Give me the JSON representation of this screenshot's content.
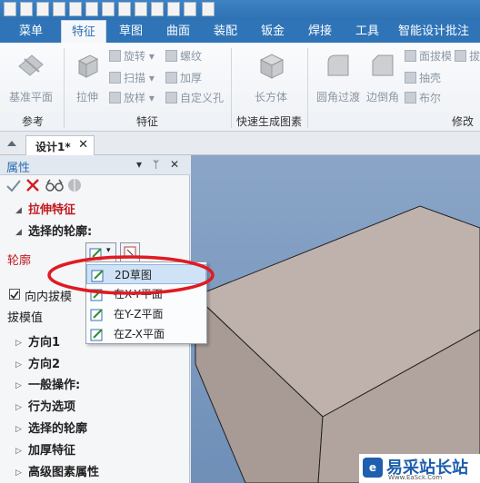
{
  "ribbon": {
    "tabs": [
      {
        "label": "菜单"
      },
      {
        "label": "特征"
      },
      {
        "label": "草图"
      },
      {
        "label": "曲面"
      },
      {
        "label": "装配"
      },
      {
        "label": "钣金"
      },
      {
        "label": "焊接"
      },
      {
        "label": "工具"
      },
      {
        "label": "智能设计批注"
      }
    ],
    "active_tab": "特征",
    "groups": {
      "reference": {
        "label": "参考",
        "base_plane": "基准平面"
      },
      "feature": {
        "label": "特征",
        "extrude": "拉伸",
        "revolve": "旋转",
        "sweep": "扫描",
        "loft": "放样",
        "thread": "螺纹",
        "thicken": "加厚",
        "custom_hole": "自定义孔"
      },
      "quick": {
        "label": "快速生成图素",
        "box": "长方体"
      },
      "modify": {
        "label": "修改",
        "fillet": "圆角过渡",
        "chamfer": "边倒角",
        "draft": "面拔模",
        "shell": "抽壳",
        "boolean": "布尔",
        "extra": "拔"
      }
    }
  },
  "document": {
    "tab_label": "设计1*",
    "close": "✕"
  },
  "panel": {
    "title": "属性",
    "controls": {
      "dropdown": "▾",
      "pin": "ᛘ",
      "close": "✕"
    },
    "feature_title": "拉伸特征",
    "selected_profile": "选择的轮廓:",
    "profile_label": "轮廓",
    "inward_draft": "向内拔模",
    "inward_draft_checked": true,
    "draft_value": "拔模值",
    "sections": [
      "方向1",
      "方向2",
      "一般操作:",
      "行为选项",
      "选择的轮廓",
      "加厚特征",
      "高级图素属性"
    ]
  },
  "profile_menu": {
    "items": [
      {
        "label": "2D草图",
        "highlighted": true
      },
      {
        "label": "在X-Y平面",
        "highlighted": false
      },
      {
        "label": "在Y-Z平面",
        "highlighted": false
      },
      {
        "label": "在Z-X平面",
        "highlighted": false
      }
    ]
  },
  "watermark": {
    "text": "易采站长站",
    "url": "Www.EaSck.Com"
  },
  "colors": {
    "ribbon_blue": "#2f74b7",
    "accent_red": "#c0191e",
    "box_face": "#b5a7a1",
    "viewport_bg": "#7b98bf"
  }
}
